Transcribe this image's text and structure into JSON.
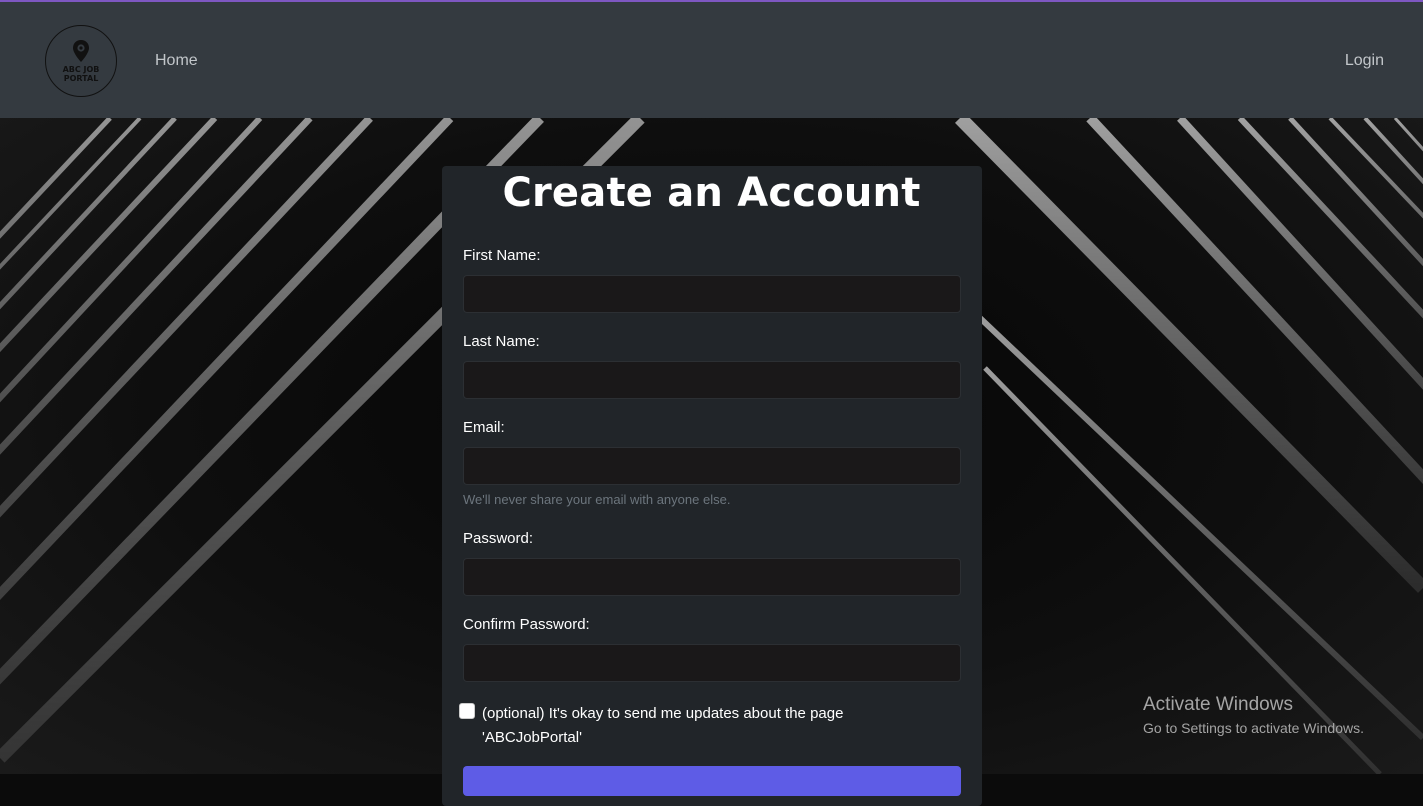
{
  "navbar": {
    "logo_text_line1": "ABC JOB",
    "logo_text_line2": "PORTAL",
    "home_label": "Home",
    "login_label": "Login"
  },
  "form": {
    "title": "Create an Account",
    "first_name_label": "First Name:",
    "first_name_value": "",
    "last_name_label": "Last Name:",
    "last_name_value": "",
    "email_label": "Email:",
    "email_value": "",
    "email_help": "We'll never share your email with anyone else.",
    "password_label": "Password:",
    "password_value": "",
    "confirm_password_label": "Confirm Password:",
    "confirm_password_value": "",
    "updates_checkbox_checked": false,
    "updates_label": "(optional) It's okay to send me updates about the page 'ABCJobPortal'"
  },
  "watermark": {
    "title": "Activate Windows",
    "subtitle": "Go to Settings to activate Windows."
  },
  "colors": {
    "navbar_bg": "#343a40",
    "top_accent": "#7e57c2",
    "card_bg": "#212529",
    "input_bg": "#1a1819",
    "button_bg": "#5e5ce6"
  }
}
